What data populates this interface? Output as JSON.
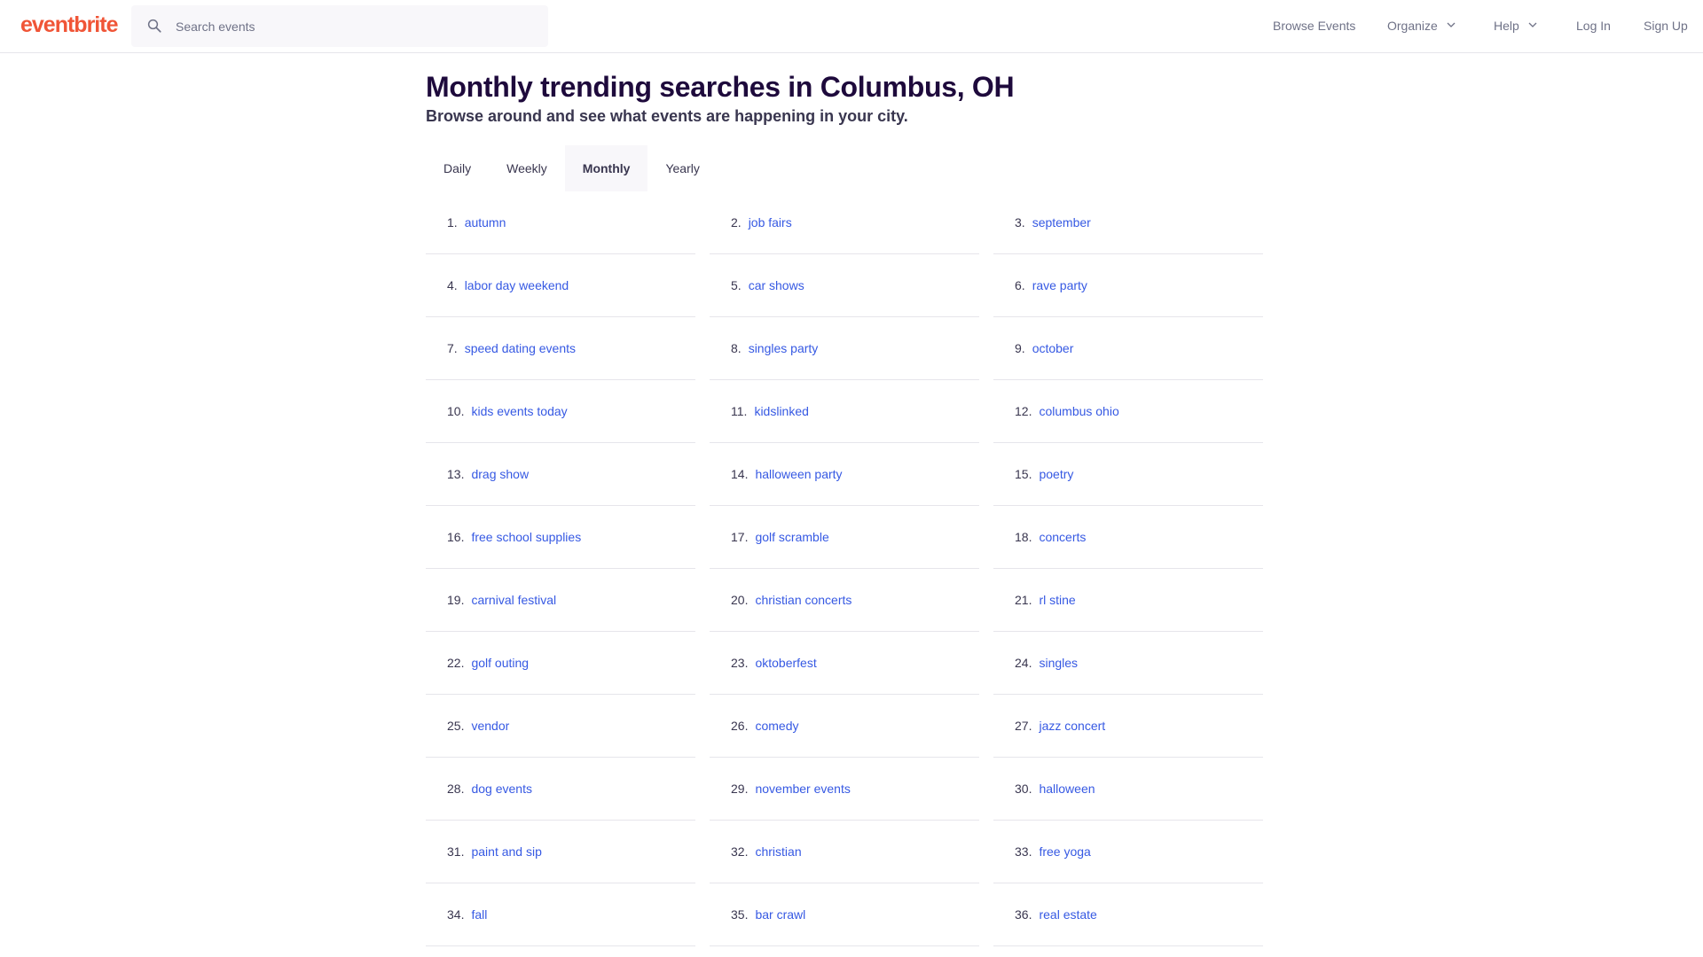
{
  "header": {
    "logo": "eventbrite",
    "search_placeholder": "Search events",
    "nav": {
      "browse": "Browse Events",
      "organize": "Organize",
      "help": "Help",
      "login": "Log In",
      "signup": "Sign Up"
    }
  },
  "page": {
    "title": "Monthly trending searches in Columbus, OH",
    "subtitle": "Browse around and see what events are happening in your city."
  },
  "tabs": [
    {
      "label": "Daily",
      "active": false
    },
    {
      "label": "Weekly",
      "active": false
    },
    {
      "label": "Monthly",
      "active": true
    },
    {
      "label": "Yearly",
      "active": false
    }
  ],
  "trending": [
    {
      "rank": "1.",
      "term": "autumn"
    },
    {
      "rank": "2.",
      "term": "job fairs"
    },
    {
      "rank": "3.",
      "term": "september"
    },
    {
      "rank": "4.",
      "term": "labor day weekend"
    },
    {
      "rank": "5.",
      "term": "car shows"
    },
    {
      "rank": "6.",
      "term": "rave party"
    },
    {
      "rank": "7.",
      "term": "speed dating events"
    },
    {
      "rank": "8.",
      "term": "singles party"
    },
    {
      "rank": "9.",
      "term": "october"
    },
    {
      "rank": "10.",
      "term": "kids events today"
    },
    {
      "rank": "11.",
      "term": "kidslinked"
    },
    {
      "rank": "12.",
      "term": "columbus ohio"
    },
    {
      "rank": "13.",
      "term": "drag show"
    },
    {
      "rank": "14.",
      "term": "halloween party"
    },
    {
      "rank": "15.",
      "term": "poetry"
    },
    {
      "rank": "16.",
      "term": "free school supplies"
    },
    {
      "rank": "17.",
      "term": "golf scramble"
    },
    {
      "rank": "18.",
      "term": "concerts"
    },
    {
      "rank": "19.",
      "term": "carnival festival"
    },
    {
      "rank": "20.",
      "term": "christian concerts"
    },
    {
      "rank": "21.",
      "term": "rl stine"
    },
    {
      "rank": "22.",
      "term": "golf outing"
    },
    {
      "rank": "23.",
      "term": "oktoberfest"
    },
    {
      "rank": "24.",
      "term": "singles"
    },
    {
      "rank": "25.",
      "term": "vendor"
    },
    {
      "rank": "26.",
      "term": "comedy"
    },
    {
      "rank": "27.",
      "term": "jazz concert"
    },
    {
      "rank": "28.",
      "term": "dog events"
    },
    {
      "rank": "29.",
      "term": "november events"
    },
    {
      "rank": "30.",
      "term": "halloween"
    },
    {
      "rank": "31.",
      "term": "paint and sip"
    },
    {
      "rank": "32.",
      "term": "christian"
    },
    {
      "rank": "33.",
      "term": "free yoga"
    },
    {
      "rank": "34.",
      "term": "fall"
    },
    {
      "rank": "35.",
      "term": "bar crawl"
    },
    {
      "rank": "36.",
      "term": "real estate"
    }
  ],
  "colors": {
    "brand": "#f05537",
    "link": "#3659e3",
    "heading": "#1e0a3c",
    "text": "#39364f",
    "muted": "#6f7287",
    "divider": "#e6e5eb"
  },
  "icons": {
    "search": "search-icon",
    "chevron": "chevron-down-icon"
  }
}
